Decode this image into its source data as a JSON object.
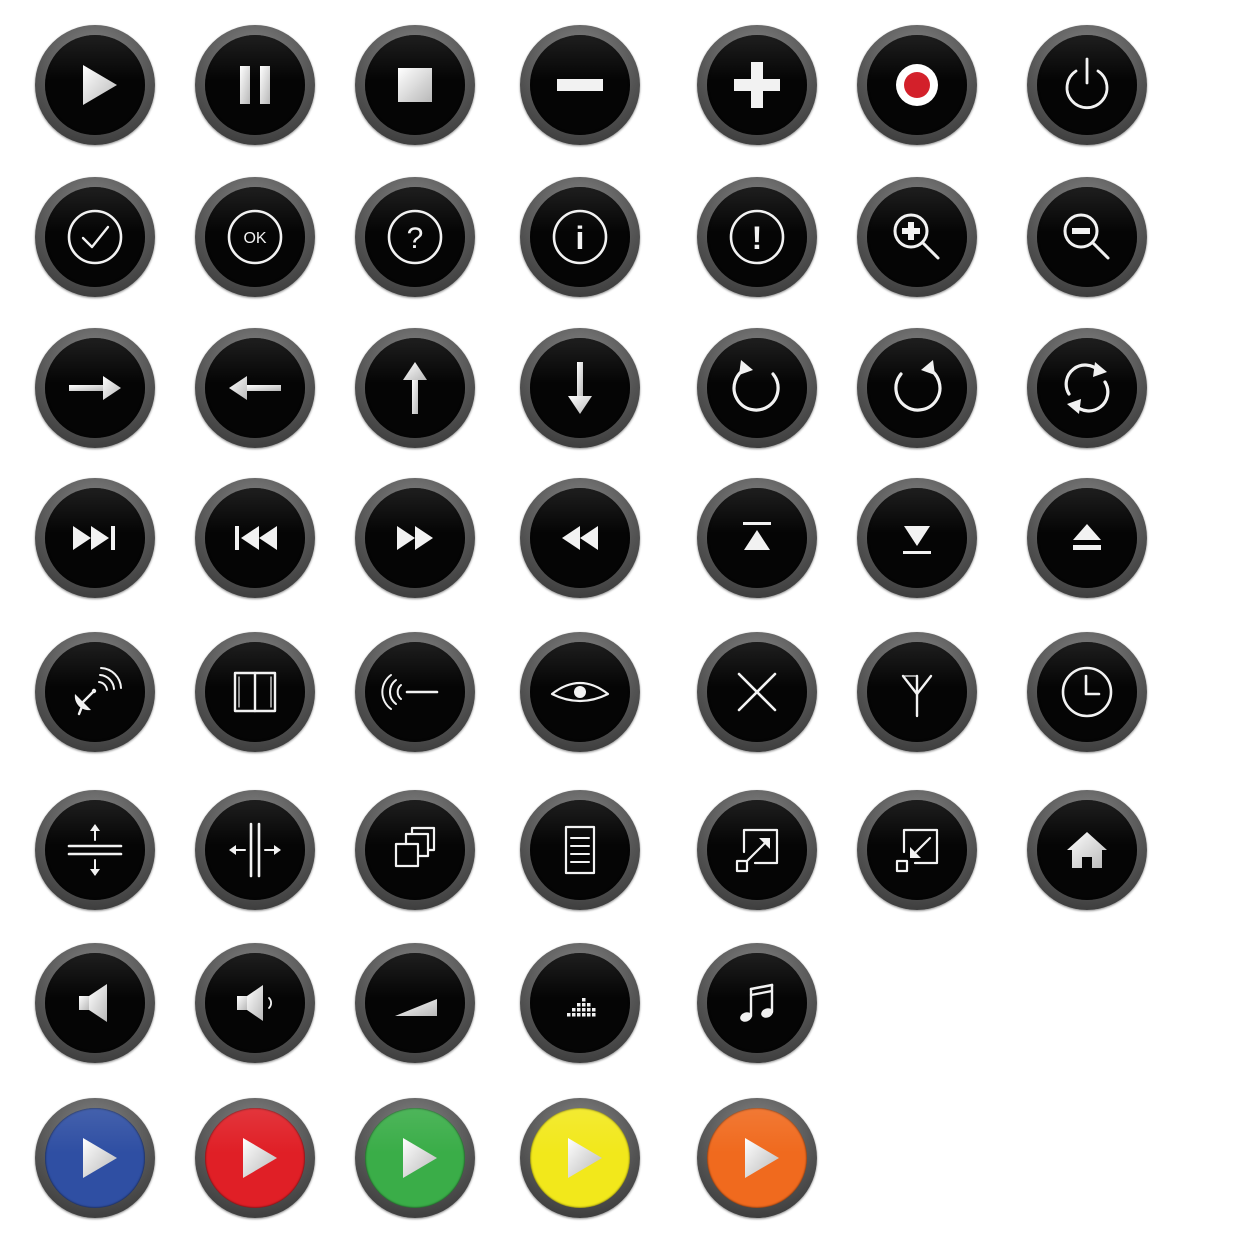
{
  "colors": {
    "button_face": "#050505",
    "button_rim": "#5c5c5c",
    "glyph": "#f2f2f2",
    "record_dot": "#d3202a"
  },
  "rows": [
    [
      {
        "icon": "play-icon",
        "face": "#050505"
      },
      {
        "icon": "pause-icon",
        "face": "#050505"
      },
      {
        "icon": "stop-icon",
        "face": "#050505"
      },
      {
        "icon": "minus-icon",
        "face": "#050505"
      },
      {
        "icon": "plus-icon",
        "face": "#050505"
      },
      {
        "icon": "record-icon",
        "face": "#050505"
      },
      {
        "icon": "power-icon",
        "face": "#050505"
      }
    ],
    [
      {
        "icon": "check-icon",
        "face": "#050505"
      },
      {
        "icon": "ok-icon",
        "face": "#050505",
        "label": "OK"
      },
      {
        "icon": "question-icon",
        "face": "#050505",
        "label": "?"
      },
      {
        "icon": "info-icon",
        "face": "#050505",
        "label": "i"
      },
      {
        "icon": "exclamation-icon",
        "face": "#050505",
        "label": "!"
      },
      {
        "icon": "zoom-in-icon",
        "face": "#050505"
      },
      {
        "icon": "zoom-out-icon",
        "face": "#050505"
      }
    ],
    [
      {
        "icon": "arrow-right-icon",
        "face": "#050505"
      },
      {
        "icon": "arrow-left-icon",
        "face": "#050505"
      },
      {
        "icon": "arrow-up-icon",
        "face": "#050505"
      },
      {
        "icon": "arrow-down-icon",
        "face": "#050505"
      },
      {
        "icon": "rotate-clockwise-icon",
        "face": "#050505"
      },
      {
        "icon": "rotate-counterclockwise-icon",
        "face": "#050505"
      },
      {
        "icon": "refresh-icon",
        "face": "#050505"
      }
    ],
    [
      {
        "icon": "skip-next-icon",
        "face": "#050505"
      },
      {
        "icon": "skip-previous-icon",
        "face": "#050505"
      },
      {
        "icon": "fast-forward-icon",
        "face": "#050505"
      },
      {
        "icon": "rewind-icon",
        "face": "#050505"
      },
      {
        "icon": "move-to-top-icon",
        "face": "#050505"
      },
      {
        "icon": "move-to-bottom-icon",
        "face": "#050505"
      },
      {
        "icon": "eject-icon",
        "face": "#050505"
      }
    ],
    [
      {
        "icon": "satellite-dish-icon",
        "face": "#050505"
      },
      {
        "icon": "book-icon",
        "face": "#050505"
      },
      {
        "icon": "wireless-signal-icon",
        "face": "#050505"
      },
      {
        "icon": "eye-icon",
        "face": "#050505"
      },
      {
        "icon": "close-icon",
        "face": "#050505"
      },
      {
        "icon": "antenna-icon",
        "face": "#050505"
      },
      {
        "icon": "clock-icon",
        "face": "#050505"
      }
    ],
    [
      {
        "icon": "split-vertical-icon",
        "face": "#050505"
      },
      {
        "icon": "split-horizontal-icon",
        "face": "#050505"
      },
      {
        "icon": "windows-icon",
        "face": "#050505"
      },
      {
        "icon": "document-icon",
        "face": "#050505"
      },
      {
        "icon": "expand-icon",
        "face": "#050505"
      },
      {
        "icon": "collapse-icon",
        "face": "#050505"
      },
      {
        "icon": "home-icon",
        "face": "#050505"
      }
    ],
    [
      {
        "icon": "speaker-mute-icon",
        "face": "#050505"
      },
      {
        "icon": "speaker-low-icon",
        "face": "#050505"
      },
      {
        "icon": "volume-ramp-icon",
        "face": "#050505"
      },
      {
        "icon": "equalizer-icon",
        "face": "#050505"
      },
      {
        "icon": "music-note-icon",
        "face": "#050505"
      }
    ],
    [
      {
        "icon": "play-icon",
        "face": "#2f4fa3"
      },
      {
        "icon": "play-icon",
        "face": "#e01f26"
      },
      {
        "icon": "play-icon",
        "face": "#3aad48"
      },
      {
        "icon": "play-icon",
        "face": "#f2e81b"
      },
      {
        "icon": "play-icon",
        "face": "#f06a1e"
      }
    ]
  ]
}
